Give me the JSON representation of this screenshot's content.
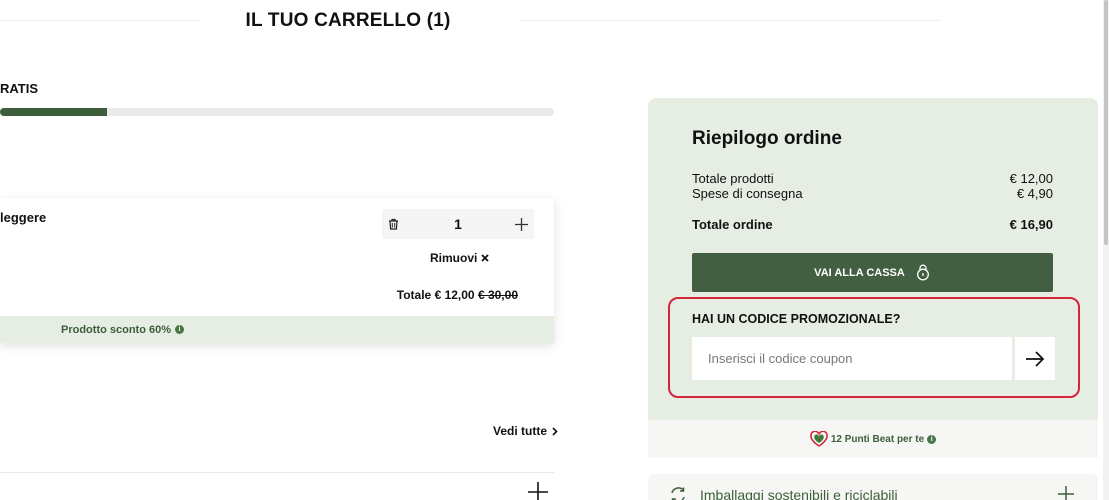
{
  "cart": {
    "title": "IL TUO CARRELLO (1)"
  },
  "shipping": {
    "message": "RATIS",
    "progress_fraction": 0.193
  },
  "item": {
    "name": "leggere",
    "quantity": "1",
    "remove_label": "Rimuovi",
    "total_label": "Totale € 12,00",
    "original_price": "€ 30,00",
    "discount_text": "Prodotto sconto 60%"
  },
  "recommendations": {
    "see_all_label": "Vedi tutte"
  },
  "summary": {
    "title": "Riepilogo ordine",
    "products_label": "Totale prodotti",
    "products_value": "€ 12,00",
    "shipping_label": "Spese di consegna",
    "shipping_value": "€ 4,90",
    "total_label": "Totale ordine",
    "total_value": "€ 16,90",
    "checkout_label": "VAI ALLA CASSA"
  },
  "promo": {
    "title": "HAI UN CODICE PROMOZIONALE?",
    "placeholder": "Inserisci il codice coupon",
    "value": ""
  },
  "points": {
    "text": "12 Punti Beat per te"
  },
  "eco": {
    "text": "Imballaggi sostenibili e riciclabili"
  },
  "colors": {
    "brand_green": "#435f41",
    "panel_bg": "#e6ede3",
    "highlight_red": "#d4253b"
  }
}
